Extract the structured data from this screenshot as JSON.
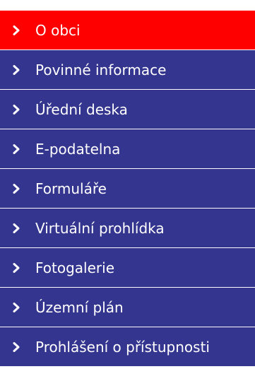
{
  "menu": {
    "active_color": "#ff0000",
    "background_color": "#34358f",
    "text_color": "#ffffff",
    "chevron_icon": "chevron-right-icon",
    "items": [
      {
        "label": "O obci",
        "active": true
      },
      {
        "label": "Povinné informace",
        "active": false
      },
      {
        "label": "Úřední deska",
        "active": false
      },
      {
        "label": "E-podatelna",
        "active": false
      },
      {
        "label": "Formuláře",
        "active": false
      },
      {
        "label": "Virtuální prohlídka",
        "active": false
      },
      {
        "label": "Fotogalerie",
        "active": false
      },
      {
        "label": "Územní plán",
        "active": false
      },
      {
        "label": "Prohlášení o přístupnosti",
        "active": false
      }
    ]
  }
}
